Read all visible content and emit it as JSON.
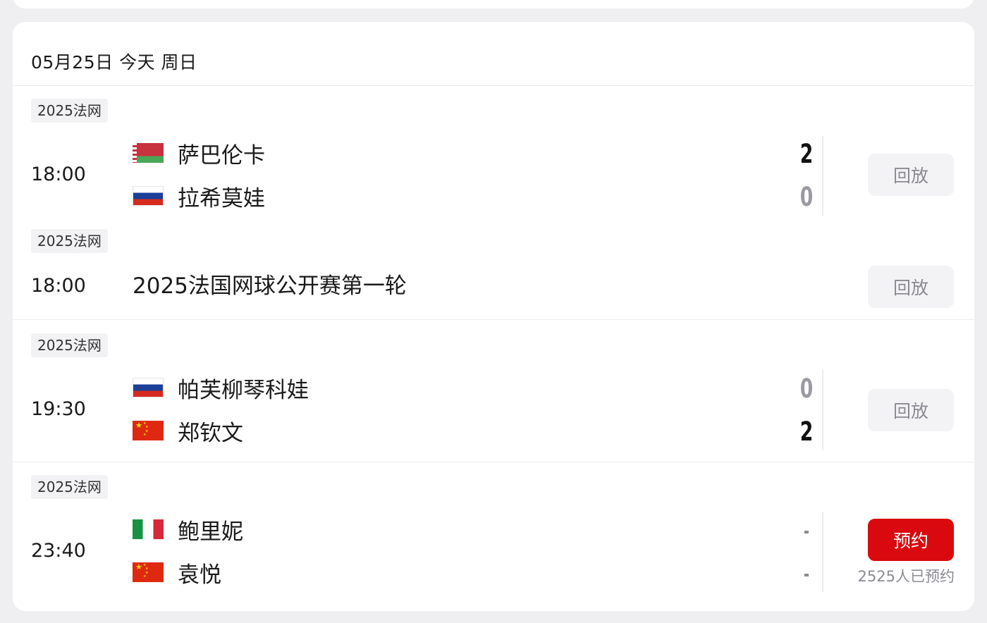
{
  "header": {
    "date": "05月25日 今天 周日"
  },
  "matches": [
    {
      "tag": "2025法网",
      "time": "18:00",
      "players": [
        {
          "name": "萨巴伦卡",
          "flag": "belarus-flag-icon",
          "score": "2"
        },
        {
          "name": "拉希莫娃",
          "flag": "russia-flag-icon",
          "score": "0"
        }
      ],
      "action": "回放"
    },
    {
      "tag": "2025法网",
      "time": "18:00",
      "title": "2025法国网球公开赛第一轮",
      "action": "回放"
    },
    {
      "tag": "2025法网",
      "time": "19:30",
      "players": [
        {
          "name": "帕芙柳琴科娃",
          "flag": "russia-flag-icon",
          "score": "0"
        },
        {
          "name": "郑钦文",
          "flag": "china-flag-icon",
          "score": "2"
        }
      ],
      "action": "回放"
    },
    {
      "tag": "2025法网",
      "time": "23:40",
      "players": [
        {
          "name": "鲍里妮",
          "flag": "italy-flag-icon",
          "score": "-"
        },
        {
          "name": "袁悦",
          "flag": "china-flag-icon",
          "score": "-"
        }
      ],
      "action": "预约",
      "reserve_count": "2525人已预约"
    }
  ],
  "colors": {
    "reserve_button": "#d9090f",
    "replay_button": "#f3f3f5",
    "muted_text": "#8a8a92"
  }
}
